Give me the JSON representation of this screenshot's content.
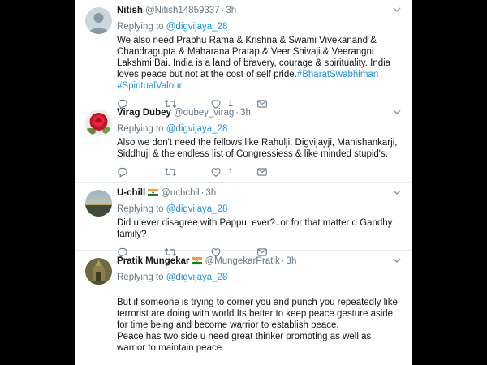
{
  "colors": {
    "link": "#1b95e0",
    "text": "#14171a",
    "muted": "#657786",
    "backdrop": "#000000"
  },
  "tweets": [
    {
      "name": "Nitish",
      "handle": "@Nitish14859337",
      "time": "3h",
      "flag": false,
      "avatar": "default-avatar",
      "replying_prefix": "Replying to",
      "replying_to": "@digvijaya_28",
      "text": "We also need Prabhu Rama & Krishna & Swami Vivekanand & Chandragupta & Maharana  Pratap & Veer Shivaji & Veerangni Lakshmi Bai. India is a land of bravery, courage & spirituality. India loves peace but not at the cost of self pride.",
      "hashtags": "#BharatSwabhiman #SpiritualValour",
      "like_count": "1"
    },
    {
      "name": "Virag Dubey",
      "handle": "@dubey_virag",
      "time": "3h",
      "flag": false,
      "avatar": "rose-avatar",
      "replying_prefix": "Replying to",
      "replying_to": "@digvijaya_28",
      "text": "Also we don't need the fellows like Rahulji, Digvijayji, Manishankarji, Siddhuji & the endless list of Congressiess & like minded stupid's.",
      "hashtags": "",
      "like_count": "1"
    },
    {
      "name": "U-chill",
      "handle": "@uchchil",
      "time": "3h",
      "flag": true,
      "avatar": "sunset-avatar",
      "replying_prefix": "Replying to",
      "replying_to": "@digvijaya_28",
      "text": "Did u ever disagree with Pappu, ever?..or for that matter d Gandhy family?",
      "hashtags": "",
      "like_count": ""
    },
    {
      "name": "Pratik Mungekar",
      "handle": "@MungekarPratik",
      "time": "3h",
      "flag": true,
      "avatar": "temple-avatar",
      "replying_prefix": "Replying to",
      "replying_to": "@digvijaya_28",
      "text": "But if someone is trying to corner you and punch you repeatedly like terrorist are doing with world.Its better to keep peace gesture aside for time being and become warrior to establish peace.\nPeace has two side u need great thinker promoting as well as warrior to maintain peace",
      "hashtags": "",
      "like_count": ""
    }
  ]
}
